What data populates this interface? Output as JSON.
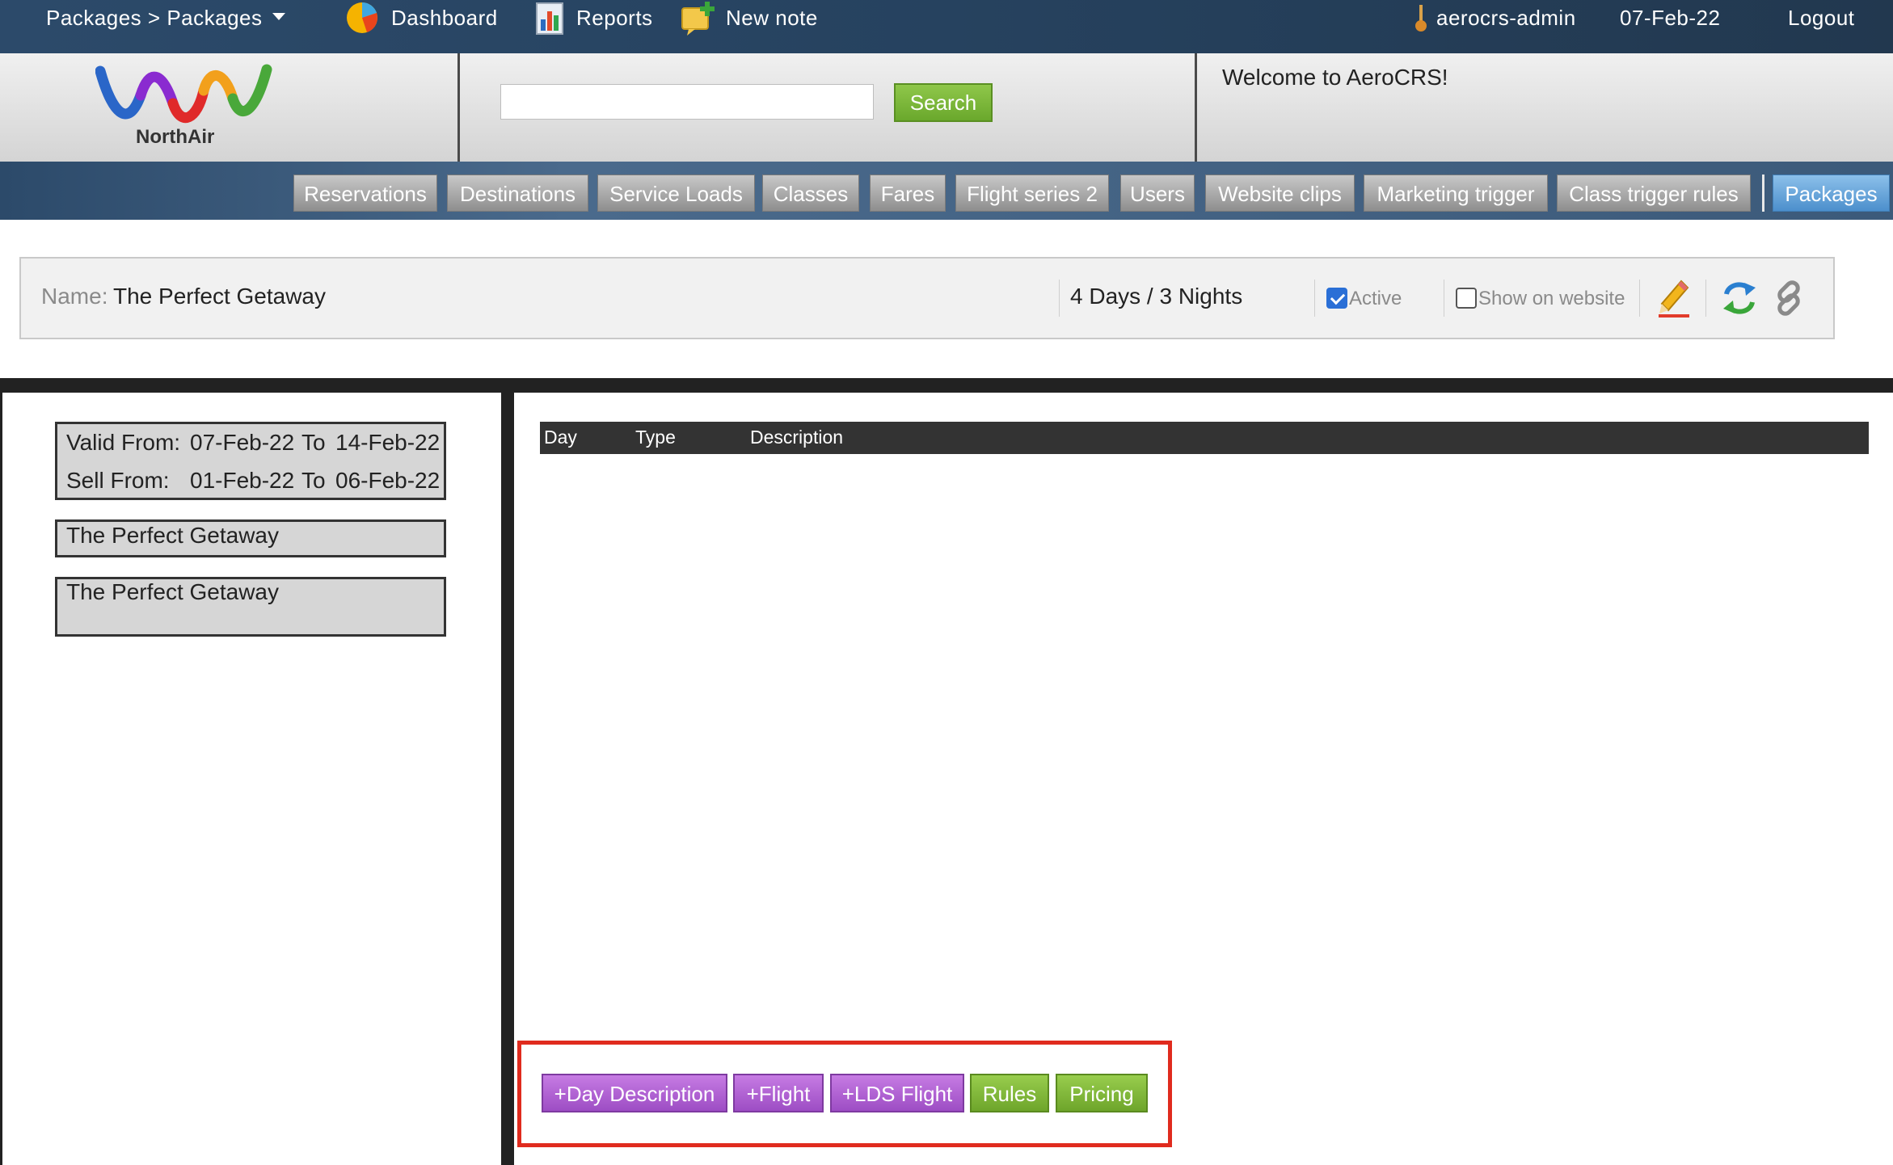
{
  "topbar": {
    "breadcrumb": "Packages > Packages",
    "dashboard_label": "Dashboard",
    "reports_label": "Reports",
    "new_note_label": "New note",
    "username": "aerocrs-admin",
    "date": "07-Feb-22",
    "logout_label": "Logout"
  },
  "header": {
    "logo_text": "NorthAir",
    "search_placeholder": "",
    "search_button": "Search",
    "welcome": "Welcome to AeroCRS!"
  },
  "nav": {
    "items": [
      {
        "label": "Reservations"
      },
      {
        "label": "Destinations"
      },
      {
        "label": "Service Loads"
      },
      {
        "label": "Classes"
      },
      {
        "label": "Fares"
      },
      {
        "label": "Flight series 2"
      },
      {
        "label": "Users"
      },
      {
        "label": "Website clips"
      },
      {
        "label": "Marketing trigger"
      },
      {
        "label": "Class trigger rules"
      },
      {
        "label": "Packages",
        "active": true
      }
    ]
  },
  "package": {
    "name_label": "Name:",
    "name": "The Perfect Getaway",
    "duration": "4 Days / 3 Nights",
    "active_label": "Active",
    "active_checked": true,
    "show_on_website_label": "Show on website",
    "show_on_website_checked": false,
    "icons": [
      "edit-icon",
      "refresh-icon",
      "link-icon"
    ]
  },
  "validity": {
    "valid_from_label": "Valid From:",
    "valid_from": "07-Feb-22",
    "to_label": "To",
    "valid_to": "14-Feb-22",
    "sell_from_label": "Sell From:",
    "sell_from": "01-Feb-22",
    "sell_to": "06-Feb-22"
  },
  "left_panel": {
    "title_box": "The Perfect Getaway",
    "description_box": "The Perfect Getaway"
  },
  "table": {
    "columns": [
      "Day",
      "Type",
      "Description"
    ],
    "rows": []
  },
  "actions": {
    "day_description": "+Day Description",
    "flight": "+Flight",
    "lds_flight": "+LDS Flight",
    "rules": "Rules",
    "pricing": "Pricing"
  },
  "colors": {
    "topbar": "#26425f",
    "search_button": "#6aa82c",
    "nav_active": "#4c8fcc",
    "action_purple": "#9d4dc4",
    "action_green": "#6ea52b",
    "highlight": "#e02b1e"
  }
}
